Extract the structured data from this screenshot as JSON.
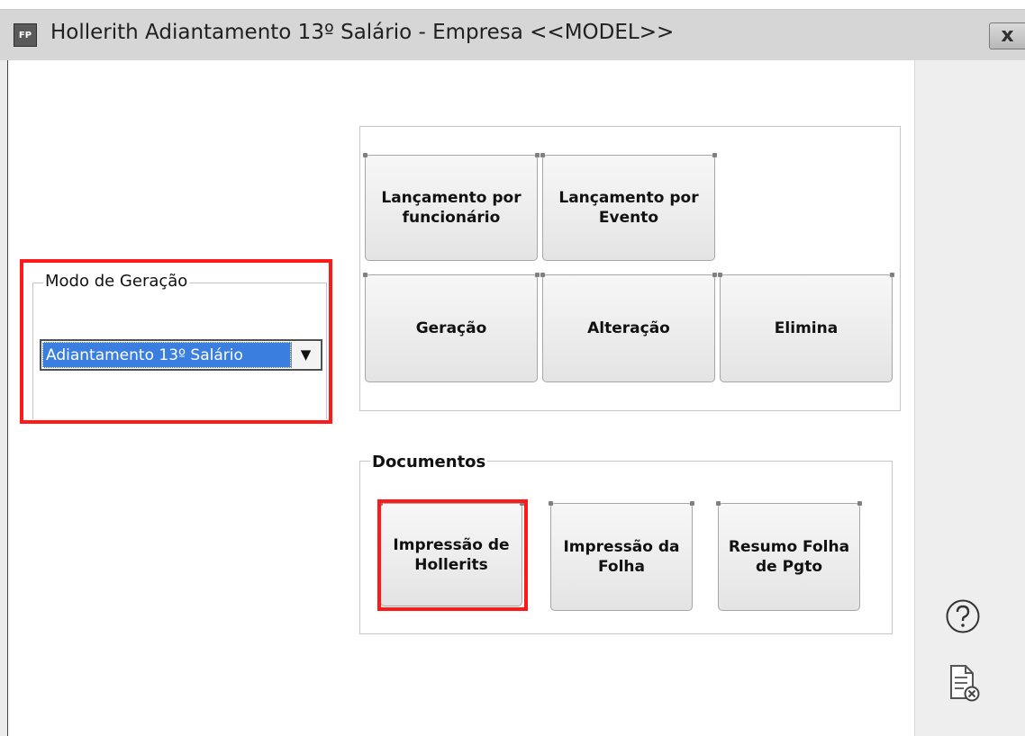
{
  "window": {
    "app_icon": "FP",
    "title": "Hollerith Adiantamento 13º Salário - Empresa <<MODEL>>",
    "close_label": "x"
  },
  "modo_geracao": {
    "label": "Modo de Geração",
    "selected": "Adiantamento 13º Salário",
    "arrow": "▼"
  },
  "actions": {
    "lancamento_funcionario": "Lançamento por\nfuncionário",
    "lancamento_evento": "Lançamento por\nEvento",
    "geracao": "Geração",
    "alteracao": "Alteração",
    "elimina": "Elimina"
  },
  "documentos": {
    "label": "Documentos",
    "impressao_hollerits": "Impressão de\nHollerits",
    "impressao_folha": "Impressão da\nFolha",
    "resumo_folha": "Resumo Folha\nde Pgto"
  },
  "side_icons": [
    "help-icon",
    "document-close-icon"
  ],
  "colors": {
    "highlight": "#ff1a1a",
    "selection": "#3a7fe0"
  }
}
